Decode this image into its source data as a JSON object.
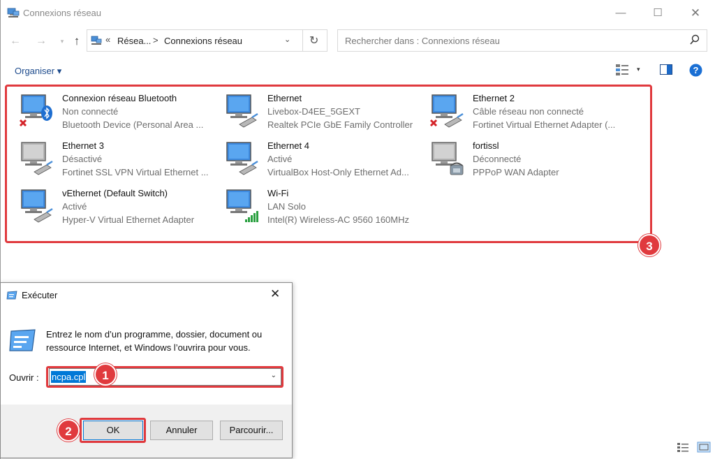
{
  "explorer": {
    "title": "Connexions réseau",
    "window_controls": {
      "minimize": "—",
      "maximize": "☐",
      "close": "✕"
    },
    "nav": {
      "back": "←",
      "forward": "→",
      "dropdown": "▾",
      "up": "↑"
    },
    "address": {
      "overflow": "«",
      "crumb1": "Résea...",
      "separator": ">",
      "crumb2": "Connexions réseau",
      "dropdown": "⌄",
      "refresh": "↻"
    },
    "search_placeholder": "Rechercher dans : Connexions réseau",
    "toolbar": {
      "organiser": "Organiser ▾",
      "view_dropdown": "▾"
    },
    "connections": [
      {
        "name": "Connexion réseau Bluetooth",
        "status": "Non connecté",
        "device": "Bluetooth Device (Personal Area ...",
        "icon": "bluetooth-network-icon"
      },
      {
        "name": "Ethernet",
        "status": "Livebox-D4EE_5GEXT",
        "device": "Realtek PCIe GbE Family Controller",
        "icon": "ethernet-network-icon"
      },
      {
        "name": "Ethernet 2",
        "status": "Câble réseau non connecté",
        "device": "Fortinet Virtual Ethernet Adapter (...",
        "icon": "ethernet-disconnected-icon"
      },
      {
        "name": "Ethernet 3",
        "status": "Désactivé",
        "device": "Fortinet SSL VPN Virtual Ethernet ...",
        "icon": "ethernet-disabled-icon"
      },
      {
        "name": "Ethernet 4",
        "status": "Activé",
        "device": "VirtualBox Host-Only Ethernet Ad...",
        "icon": "ethernet-network-icon"
      },
      {
        "name": "fortissl",
        "status": "Déconnecté",
        "device": "PPPoP WAN Adapter",
        "icon": "dialup-disabled-icon"
      },
      {
        "name": "vEthernet (Default Switch)",
        "status": "Activé",
        "device": "Hyper-V Virtual Ethernet Adapter",
        "icon": "ethernet-network-icon"
      },
      {
        "name": "Wi-Fi",
        "status": "LAN Solo",
        "device": "Intel(R) Wireless-AC 9560 160MHz",
        "icon": "wifi-network-icon"
      }
    ],
    "badge3": "3"
  },
  "run_dialog": {
    "title": "Exécuter",
    "close": "✕",
    "description": "Entrez le nom d’un programme, dossier, document ou ressource Internet, et Windows l’ouvrira pour vous.",
    "open_label": "Ouvrir :",
    "open_value": "ncpa.cpl",
    "combo_dropdown": "⌄",
    "buttons": {
      "ok": "OK",
      "cancel": "Annuler",
      "browse": "Parcourir..."
    },
    "badge1": "1",
    "badge2": "2"
  },
  "colors": {
    "highlight": "#e03a3e",
    "selection": "#0078d7",
    "link": "#1c4a8c"
  }
}
